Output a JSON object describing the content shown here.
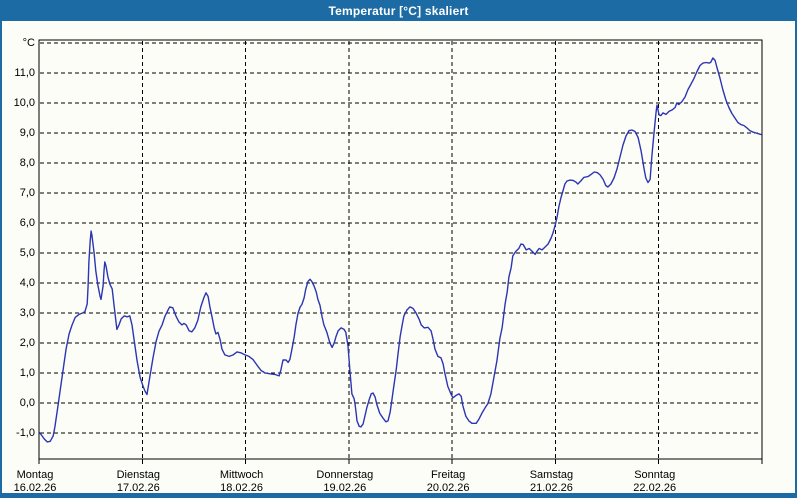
{
  "window": {
    "title": "Temperatur [°C] skaliert",
    "title_bar_color": "#1c6ba4",
    "frame_border_color": "#1c6ba4",
    "content_background": "#fcfdf6"
  },
  "chart_data": {
    "type": "line",
    "title": "Temperatur [°C] skaliert",
    "grid": "dashed",
    "legend": "none",
    "y_axis": {
      "unit_label": "°C",
      "ylim": [
        -1.87,
        12.1
      ],
      "grid_min": -1,
      "grid_max": 12,
      "grid_step": 1,
      "tick_labels": [
        {
          "v": 11,
          "label": "11,0"
        },
        {
          "v": 10,
          "label": "10,0"
        },
        {
          "v": 9,
          "label": "9,0"
        },
        {
          "v": 8,
          "label": "8,0"
        },
        {
          "v": 7,
          "label": "7,0"
        },
        {
          "v": 6,
          "label": "6,0"
        },
        {
          "v": 5,
          "label": "5,0"
        },
        {
          "v": 4,
          "label": "4,0"
        },
        {
          "v": 3,
          "label": "3,0"
        },
        {
          "v": 2,
          "label": "2,0"
        },
        {
          "v": 1,
          "label": "1,0"
        },
        {
          "v": 0,
          "label": "0,0"
        },
        {
          "v": -1,
          "label": "-1,0"
        }
      ]
    },
    "x_axis": {
      "hours_range": [
        0,
        168
      ],
      "days": [
        {
          "name": "Montag",
          "date": "16.02.26"
        },
        {
          "name": "Dienstag",
          "date": "17.02.26"
        },
        {
          "name": "Mittwoch",
          "date": "18.02.26"
        },
        {
          "name": "Donnerstag",
          "date": "19.02.26"
        },
        {
          "name": "Freitag",
          "date": "20.02.26"
        },
        {
          "name": "Samstag",
          "date": "21.02.26"
        },
        {
          "name": "Sonntag",
          "date": "22.02.26"
        }
      ]
    },
    "series": [
      {
        "name": "Temperatur",
        "color": "#2c35b4",
        "points": [
          [
            0.2,
            -1.0
          ],
          [
            1.2,
            -1.2
          ],
          [
            1.9,
            -1.3
          ],
          [
            2.6,
            -1.28
          ],
          [
            3.3,
            -1.1
          ],
          [
            3.7,
            -0.8
          ],
          [
            4.2,
            -0.3
          ],
          [
            4.9,
            0.4
          ],
          [
            5.6,
            1.1
          ],
          [
            6.3,
            1.8
          ],
          [
            7.0,
            2.3
          ],
          [
            7.7,
            2.6
          ],
          [
            8.4,
            2.85
          ],
          [
            9.3,
            2.95
          ],
          [
            10.2,
            3.0
          ],
          [
            10.7,
            3.05
          ],
          [
            11.2,
            3.3
          ],
          [
            11.4,
            3.9
          ],
          [
            11.6,
            4.7
          ],
          [
            11.9,
            5.4
          ],
          [
            12.1,
            5.73
          ],
          [
            12.3,
            5.6
          ],
          [
            12.8,
            5.0
          ],
          [
            13.2,
            4.4
          ],
          [
            13.7,
            3.9
          ],
          [
            14.2,
            3.55
          ],
          [
            14.4,
            3.45
          ],
          [
            14.9,
            3.9
          ],
          [
            15.1,
            4.4
          ],
          [
            15.3,
            4.7
          ],
          [
            15.6,
            4.55
          ],
          [
            16.0,
            4.2
          ],
          [
            16.5,
            3.95
          ],
          [
            17.0,
            3.8
          ],
          [
            17.4,
            3.3
          ],
          [
            17.9,
            2.7
          ],
          [
            18.1,
            2.45
          ],
          [
            18.6,
            2.6
          ],
          [
            19.1,
            2.8
          ],
          [
            19.8,
            2.9
          ],
          [
            20.5,
            2.87
          ],
          [
            21.1,
            2.9
          ],
          [
            21.6,
            2.6
          ],
          [
            22.1,
            2.1
          ],
          [
            22.8,
            1.4
          ],
          [
            23.5,
            0.85
          ],
          [
            24.2,
            0.55
          ],
          [
            24.6,
            0.4
          ],
          [
            25.1,
            0.28
          ],
          [
            25.8,
            0.9
          ],
          [
            26.5,
            1.5
          ],
          [
            27.2,
            2.05
          ],
          [
            27.9,
            2.4
          ],
          [
            28.6,
            2.6
          ],
          [
            29.3,
            2.9
          ],
          [
            30.0,
            3.1
          ],
          [
            30.4,
            3.2
          ],
          [
            31.1,
            3.17
          ],
          [
            31.8,
            2.9
          ],
          [
            32.5,
            2.7
          ],
          [
            33.2,
            2.6
          ],
          [
            33.7,
            2.65
          ],
          [
            34.2,
            2.6
          ],
          [
            34.9,
            2.4
          ],
          [
            35.5,
            2.37
          ],
          [
            36.2,
            2.5
          ],
          [
            36.9,
            2.75
          ],
          [
            37.6,
            3.2
          ],
          [
            38.3,
            3.5
          ],
          [
            38.8,
            3.67
          ],
          [
            39.3,
            3.55
          ],
          [
            39.7,
            3.2
          ],
          [
            40.2,
            2.87
          ],
          [
            40.7,
            2.5
          ],
          [
            41.1,
            2.3
          ],
          [
            41.6,
            2.35
          ],
          [
            42.1,
            2.1
          ],
          [
            42.5,
            1.8
          ],
          [
            43.2,
            1.6
          ],
          [
            44.2,
            1.55
          ],
          [
            45.1,
            1.6
          ],
          [
            46.0,
            1.7
          ],
          [
            46.9,
            1.67
          ],
          [
            47.9,
            1.6
          ],
          [
            48.8,
            1.55
          ],
          [
            49.7,
            1.45
          ],
          [
            50.7,
            1.25
          ],
          [
            51.6,
            1.08
          ],
          [
            52.5,
            1.0
          ],
          [
            53.7,
            0.97
          ],
          [
            54.8,
            0.95
          ],
          [
            55.8,
            0.9
          ],
          [
            56.2,
            1.1
          ],
          [
            56.7,
            1.43
          ],
          [
            57.4,
            1.43
          ],
          [
            57.9,
            1.35
          ],
          [
            58.3,
            1.45
          ],
          [
            58.8,
            1.8
          ],
          [
            59.3,
            2.2
          ],
          [
            59.7,
            2.6
          ],
          [
            60.2,
            3.0
          ],
          [
            60.7,
            3.2
          ],
          [
            61.1,
            3.28
          ],
          [
            61.6,
            3.5
          ],
          [
            62.0,
            3.8
          ],
          [
            62.5,
            4.05
          ],
          [
            63.0,
            4.12
          ],
          [
            63.4,
            4.05
          ],
          [
            63.9,
            3.9
          ],
          [
            64.4,
            3.7
          ],
          [
            64.8,
            3.45
          ],
          [
            65.3,
            3.25
          ],
          [
            65.8,
            2.85
          ],
          [
            66.2,
            2.6
          ],
          [
            66.9,
            2.35
          ],
          [
            67.6,
            2.0
          ],
          [
            68.1,
            1.85
          ],
          [
            68.6,
            2.0
          ],
          [
            69.0,
            2.2
          ],
          [
            69.5,
            2.4
          ],
          [
            70.2,
            2.5
          ],
          [
            70.9,
            2.45
          ],
          [
            71.3,
            2.35
          ],
          [
            71.8,
            1.9
          ],
          [
            72.3,
            1.0
          ],
          [
            72.7,
            0.3
          ],
          [
            73.2,
            0.15
          ],
          [
            73.4,
            0.0
          ],
          [
            73.7,
            -0.35
          ],
          [
            73.9,
            -0.6
          ],
          [
            74.4,
            -0.78
          ],
          [
            74.8,
            -0.8
          ],
          [
            75.3,
            -0.7
          ],
          [
            75.8,
            -0.4
          ],
          [
            76.2,
            -0.15
          ],
          [
            76.7,
            0.1
          ],
          [
            77.2,
            0.3
          ],
          [
            77.6,
            0.33
          ],
          [
            78.1,
            0.2
          ],
          [
            78.5,
            -0.05
          ],
          [
            79.2,
            -0.35
          ],
          [
            79.9,
            -0.5
          ],
          [
            80.6,
            -0.63
          ],
          [
            81.1,
            -0.6
          ],
          [
            81.6,
            -0.3
          ],
          [
            82.0,
            0.1
          ],
          [
            82.5,
            0.6
          ],
          [
            83.0,
            1.1
          ],
          [
            83.4,
            1.6
          ],
          [
            83.9,
            2.2
          ],
          [
            84.4,
            2.6
          ],
          [
            84.8,
            2.9
          ],
          [
            85.5,
            3.1
          ],
          [
            86.2,
            3.2
          ],
          [
            86.9,
            3.15
          ],
          [
            87.6,
            3.0
          ],
          [
            88.3,
            2.8
          ],
          [
            88.8,
            2.6
          ],
          [
            89.5,
            2.5
          ],
          [
            90.4,
            2.52
          ],
          [
            91.1,
            2.4
          ],
          [
            91.6,
            2.1
          ],
          [
            92.0,
            1.8
          ],
          [
            92.7,
            1.55
          ],
          [
            93.4,
            1.5
          ],
          [
            93.9,
            1.3
          ],
          [
            94.3,
            1.0
          ],
          [
            95.0,
            0.55
          ],
          [
            95.7,
            0.3
          ],
          [
            96.2,
            0.17
          ],
          [
            96.9,
            0.25
          ],
          [
            97.6,
            0.3
          ],
          [
            98.1,
            0.22
          ],
          [
            98.5,
            -0.1
          ],
          [
            99.2,
            -0.45
          ],
          [
            99.9,
            -0.6
          ],
          [
            100.6,
            -0.68
          ],
          [
            101.6,
            -0.68
          ],
          [
            102.2,
            -0.55
          ],
          [
            102.9,
            -0.35
          ],
          [
            103.6,
            -0.18
          ],
          [
            104.3,
            -0.02
          ],
          [
            105.0,
            0.3
          ],
          [
            105.7,
            0.85
          ],
          [
            106.4,
            1.4
          ],
          [
            107.1,
            2.15
          ],
          [
            107.6,
            2.5
          ],
          [
            108.3,
            3.3
          ],
          [
            108.8,
            3.7
          ],
          [
            109.2,
            4.2
          ],
          [
            109.7,
            4.5
          ],
          [
            110.1,
            4.9
          ],
          [
            110.8,
            5.05
          ],
          [
            111.5,
            5.15
          ],
          [
            112.0,
            5.3
          ],
          [
            112.5,
            5.28
          ],
          [
            113.2,
            5.1
          ],
          [
            113.9,
            5.15
          ],
          [
            114.6,
            5.05
          ],
          [
            115.3,
            4.95
          ],
          [
            115.7,
            5.05
          ],
          [
            116.2,
            5.15
          ],
          [
            116.9,
            5.1
          ],
          [
            117.6,
            5.2
          ],
          [
            118.3,
            5.3
          ],
          [
            119.0,
            5.5
          ],
          [
            119.4,
            5.65
          ],
          [
            119.9,
            5.9
          ],
          [
            120.4,
            6.2
          ],
          [
            120.8,
            6.55
          ],
          [
            121.3,
            6.85
          ],
          [
            121.8,
            7.1
          ],
          [
            122.2,
            7.3
          ],
          [
            122.7,
            7.4
          ],
          [
            123.4,
            7.43
          ],
          [
            124.1,
            7.42
          ],
          [
            124.8,
            7.36
          ],
          [
            125.2,
            7.3
          ],
          [
            125.9,
            7.4
          ],
          [
            126.6,
            7.52
          ],
          [
            127.6,
            7.55
          ],
          [
            128.3,
            7.62
          ],
          [
            129.0,
            7.7
          ],
          [
            129.7,
            7.68
          ],
          [
            130.4,
            7.6
          ],
          [
            131.1,
            7.45
          ],
          [
            131.7,
            7.25
          ],
          [
            132.2,
            7.2
          ],
          [
            132.9,
            7.3
          ],
          [
            133.6,
            7.5
          ],
          [
            134.3,
            7.8
          ],
          [
            135.0,
            8.2
          ],
          [
            135.7,
            8.6
          ],
          [
            136.4,
            8.9
          ],
          [
            137.1,
            9.08
          ],
          [
            137.8,
            9.1
          ],
          [
            138.5,
            9.05
          ],
          [
            139.2,
            8.85
          ],
          [
            139.9,
            8.4
          ],
          [
            140.6,
            7.8
          ],
          [
            141.0,
            7.5
          ],
          [
            141.5,
            7.35
          ],
          [
            142.0,
            7.45
          ],
          [
            142.4,
            8.2
          ],
          [
            142.9,
            9.0
          ],
          [
            143.4,
            9.7
          ],
          [
            143.6,
            9.93
          ],
          [
            144.1,
            9.6
          ],
          [
            144.5,
            9.58
          ],
          [
            145.0,
            9.67
          ],
          [
            145.7,
            9.62
          ],
          [
            146.4,
            9.72
          ],
          [
            147.1,
            9.77
          ],
          [
            147.8,
            9.85
          ],
          [
            148.2,
            10.0
          ],
          [
            148.7,
            9.95
          ],
          [
            149.4,
            10.05
          ],
          [
            150.1,
            10.2
          ],
          [
            150.8,
            10.45
          ],
          [
            151.5,
            10.63
          ],
          [
            152.2,
            10.82
          ],
          [
            152.9,
            11.05
          ],
          [
            153.6,
            11.25
          ],
          [
            154.3,
            11.33
          ],
          [
            155.0,
            11.35
          ],
          [
            155.7,
            11.33
          ],
          [
            156.1,
            11.36
          ],
          [
            156.6,
            11.5
          ],
          [
            157.1,
            11.42
          ],
          [
            157.5,
            11.2
          ],
          [
            158.2,
            10.85
          ],
          [
            158.9,
            10.45
          ],
          [
            159.6,
            10.1
          ],
          [
            160.3,
            9.85
          ],
          [
            161.0,
            9.65
          ],
          [
            161.7,
            9.5
          ],
          [
            162.4,
            9.35
          ],
          [
            163.1,
            9.28
          ],
          [
            163.8,
            9.25
          ],
          [
            164.5,
            9.17
          ],
          [
            165.2,
            9.08
          ],
          [
            165.9,
            9.03
          ],
          [
            166.6,
            9.0
          ],
          [
            167.3,
            8.97
          ],
          [
            167.8,
            8.95
          ]
        ]
      }
    ]
  }
}
